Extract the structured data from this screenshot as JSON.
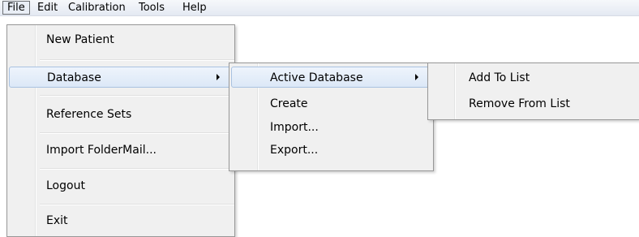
{
  "menubar": {
    "items": [
      {
        "label": "File"
      },
      {
        "label": "Edit"
      },
      {
        "label": "Calibration"
      },
      {
        "label": "Tools"
      },
      {
        "label": "Help"
      }
    ]
  },
  "file_menu": {
    "items": [
      {
        "label": "New Patient"
      },
      {
        "label": "Database"
      },
      {
        "label": "Reference Sets"
      },
      {
        "label": "Import FolderMail..."
      },
      {
        "label": "Logout"
      },
      {
        "label": "Exit"
      }
    ]
  },
  "database_menu": {
    "items": [
      {
        "label": "Active Database"
      },
      {
        "label": "Create"
      },
      {
        "label": "Import..."
      },
      {
        "label": "Export..."
      }
    ]
  },
  "active_db_menu": {
    "items": [
      {
        "label": "Add To List"
      },
      {
        "label": "Remove From List"
      }
    ]
  }
}
